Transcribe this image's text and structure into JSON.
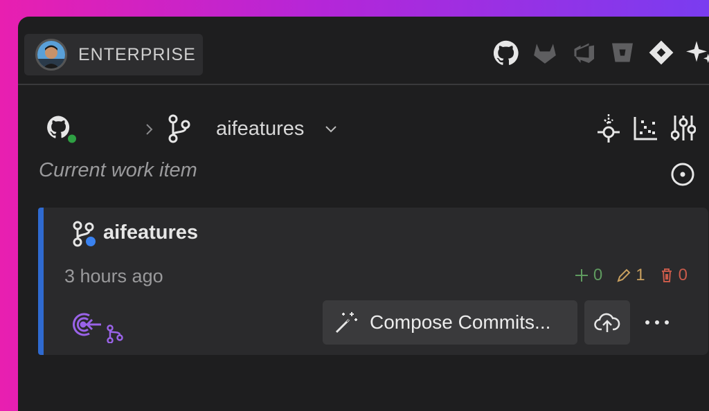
{
  "account": {
    "label": "ENTERPRISE",
    "avatar": "user-avatar"
  },
  "providers": [
    "github-icon",
    "gitlab-icon",
    "azure-devops-icon",
    "bitbucket-icon",
    "jira-icon",
    "ai-sparkle-icon"
  ],
  "repo": {
    "branch": "aifeatures",
    "status_color": "#2ea043",
    "actions": [
      "fetch-icon",
      "graph-icon",
      "branches-compare-icon"
    ]
  },
  "work_item": {
    "label": "Current work item"
  },
  "card": {
    "title": "aifeatures",
    "time": "3 hours ago",
    "stats": {
      "added": "0",
      "modified": "1",
      "deleted": "0"
    },
    "compose_label": "Compose Commits...",
    "accent": "#2f6ad0"
  }
}
